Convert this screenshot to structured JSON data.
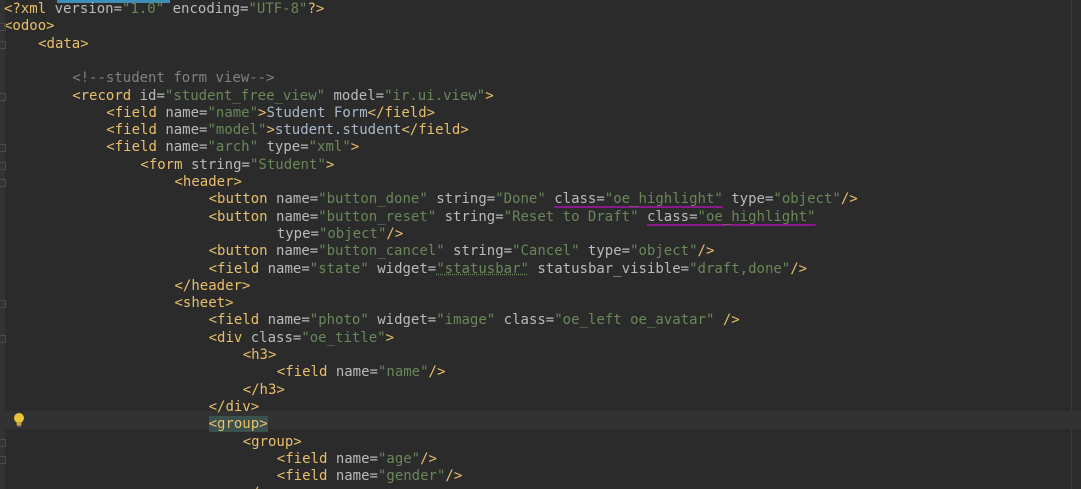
{
  "editor": {
    "language": "xml",
    "current_line": 24,
    "lines": [
      {
        "indent": 0,
        "tokens": [
          {
            "t": "pi",
            "s": "<?xml "
          },
          {
            "t": "attr",
            "s": "version="
          },
          {
            "t": "val",
            "s": "\"1.0\""
          },
          {
            "t": "attr",
            "s": " encoding="
          },
          {
            "t": "val",
            "s": "\"UTF-8\""
          },
          {
            "t": "pi",
            "s": "?>"
          }
        ]
      },
      {
        "indent": 0,
        "tokens": [
          {
            "t": "tag",
            "s": "<odoo>"
          }
        ]
      },
      {
        "indent": 1,
        "tokens": [
          {
            "t": "tag",
            "s": "<data>"
          }
        ]
      },
      {
        "indent": 0,
        "tokens": []
      },
      {
        "indent": 2,
        "tokens": [
          {
            "t": "comment",
            "s": "<!--student form view-->"
          }
        ]
      },
      {
        "indent": 2,
        "tokens": [
          {
            "t": "tag",
            "s": "<record "
          },
          {
            "t": "attr",
            "s": "id="
          },
          {
            "t": "val",
            "s": "\"student_free_view\""
          },
          {
            "t": "attr",
            "s": " model="
          },
          {
            "t": "val",
            "s": "\"ir.ui.view\""
          },
          {
            "t": "tag",
            "s": ">"
          }
        ]
      },
      {
        "indent": 3,
        "tokens": [
          {
            "t": "tag",
            "s": "<field "
          },
          {
            "t": "attr",
            "s": "name="
          },
          {
            "t": "val",
            "s": "\"name\""
          },
          {
            "t": "tag",
            "s": ">"
          },
          {
            "t": "text",
            "s": "Student Form"
          },
          {
            "t": "tag",
            "s": "</field>"
          }
        ]
      },
      {
        "indent": 3,
        "tokens": [
          {
            "t": "tag",
            "s": "<field "
          },
          {
            "t": "attr",
            "s": "name="
          },
          {
            "t": "val",
            "s": "\"model\""
          },
          {
            "t": "tag",
            "s": ">"
          },
          {
            "t": "text",
            "s": "student.student"
          },
          {
            "t": "tag",
            "s": "</field>"
          }
        ]
      },
      {
        "indent": 3,
        "tokens": [
          {
            "t": "tag",
            "s": "<field "
          },
          {
            "t": "attr",
            "s": "name="
          },
          {
            "t": "val",
            "s": "\"arch\""
          },
          {
            "t": "attr",
            "s": " type="
          },
          {
            "t": "val",
            "s": "\"xml\""
          },
          {
            "t": "tag",
            "s": ">"
          }
        ]
      },
      {
        "indent": 4,
        "tokens": [
          {
            "t": "tag",
            "s": "<form "
          },
          {
            "t": "attr",
            "s": "string="
          },
          {
            "t": "val",
            "s": "\"Student\""
          },
          {
            "t": "tag",
            "s": ">"
          }
        ]
      },
      {
        "indent": 5,
        "tokens": [
          {
            "t": "tag",
            "s": "<header>"
          }
        ]
      },
      {
        "indent": 6,
        "tokens": [
          {
            "t": "tag",
            "s": "<button "
          },
          {
            "t": "attr",
            "s": "name="
          },
          {
            "t": "val",
            "s": "\"button_done\""
          },
          {
            "t": "attr",
            "s": " string="
          },
          {
            "t": "val",
            "s": "\"Done\""
          },
          {
            "t": "attr",
            "s": " "
          },
          {
            "t": "attr",
            "s": "class=",
            "u": "purple"
          },
          {
            "t": "val",
            "s": "\"oe_highlight\"",
            "u": "purple"
          },
          {
            "t": "attr",
            "s": " type="
          },
          {
            "t": "val",
            "s": "\"object\""
          },
          {
            "t": "tag",
            "s": "/>"
          }
        ]
      },
      {
        "indent": 6,
        "tokens": [
          {
            "t": "tag",
            "s": "<button "
          },
          {
            "t": "attr",
            "s": "name="
          },
          {
            "t": "val",
            "s": "\"button_reset\""
          },
          {
            "t": "attr",
            "s": " string="
          },
          {
            "t": "val",
            "s": "\"Reset to Draft\""
          },
          {
            "t": "attr",
            "s": " "
          },
          {
            "t": "attr",
            "s": "class=",
            "u": "purple"
          },
          {
            "t": "val",
            "s": "\"oe_highlight\"",
            "u": "purple"
          }
        ]
      },
      {
        "indent": 8,
        "tokens": [
          {
            "t": "attr",
            "s": "type="
          },
          {
            "t": "val",
            "s": "\"object\""
          },
          {
            "t": "tag",
            "s": "/>"
          }
        ]
      },
      {
        "indent": 6,
        "tokens": [
          {
            "t": "tag",
            "s": "<button "
          },
          {
            "t": "attr",
            "s": "name="
          },
          {
            "t": "val",
            "s": "\"button_cancel\""
          },
          {
            "t": "attr",
            "s": " string="
          },
          {
            "t": "val",
            "s": "\"Cancel\""
          },
          {
            "t": "attr",
            "s": " type="
          },
          {
            "t": "val",
            "s": "\"object\""
          },
          {
            "t": "tag",
            "s": "/>"
          }
        ]
      },
      {
        "indent": 6,
        "tokens": [
          {
            "t": "tag",
            "s": "<field "
          },
          {
            "t": "attr",
            "s": "name="
          },
          {
            "t": "val",
            "s": "\"state\""
          },
          {
            "t": "attr",
            "s": " widget="
          },
          {
            "t": "val",
            "s": "\"statusbar\"",
            "u": "dotted"
          },
          {
            "t": "attr",
            "s": " statusbar_visible="
          },
          {
            "t": "val",
            "s": "\"draft,done\""
          },
          {
            "t": "tag",
            "s": "/>"
          }
        ]
      },
      {
        "indent": 5,
        "tokens": [
          {
            "t": "tag",
            "s": "</header>"
          }
        ]
      },
      {
        "indent": 5,
        "tokens": [
          {
            "t": "tag",
            "s": "<sheet>"
          }
        ]
      },
      {
        "indent": 6,
        "tokens": [
          {
            "t": "tag",
            "s": "<field "
          },
          {
            "t": "attr",
            "s": "name="
          },
          {
            "t": "val",
            "s": "\"photo\""
          },
          {
            "t": "attr",
            "s": " widget="
          },
          {
            "t": "val",
            "s": "\"image\""
          },
          {
            "t": "attr",
            "s": " class="
          },
          {
            "t": "val",
            "s": "\"oe_left oe_avatar\""
          },
          {
            "t": "tag",
            "s": " />"
          }
        ]
      },
      {
        "indent": 6,
        "tokens": [
          {
            "t": "tag",
            "s": "<div "
          },
          {
            "t": "attr",
            "s": "class="
          },
          {
            "t": "val",
            "s": "\"oe_title\""
          },
          {
            "t": "tag",
            "s": ">"
          }
        ]
      },
      {
        "indent": 7,
        "tokens": [
          {
            "t": "tag",
            "s": "<h3>"
          }
        ]
      },
      {
        "indent": 8,
        "tokens": [
          {
            "t": "tag",
            "s": "<field "
          },
          {
            "t": "attr",
            "s": "name="
          },
          {
            "t": "val",
            "s": "\"name\""
          },
          {
            "t": "tag",
            "s": "/>"
          }
        ]
      },
      {
        "indent": 7,
        "tokens": [
          {
            "t": "tag",
            "s": "</h3>"
          }
        ]
      },
      {
        "indent": 6,
        "tokens": [
          {
            "t": "tag",
            "s": "</div>"
          }
        ]
      },
      {
        "indent": 6,
        "tokens": [
          {
            "t": "sel",
            "s": "<group>"
          }
        ]
      },
      {
        "indent": 7,
        "tokens": [
          {
            "t": "tag",
            "s": "<group>"
          }
        ]
      },
      {
        "indent": 8,
        "tokens": [
          {
            "t": "tag",
            "s": "<field "
          },
          {
            "t": "attr",
            "s": "name="
          },
          {
            "t": "val",
            "s": "\"age\""
          },
          {
            "t": "tag",
            "s": "/>"
          }
        ]
      },
      {
        "indent": 8,
        "tokens": [
          {
            "t": "tag",
            "s": "<field "
          },
          {
            "t": "attr",
            "s": "name="
          },
          {
            "t": "val",
            "s": "\"gender\""
          },
          {
            "t": "tag",
            "s": "/>"
          }
        ]
      },
      {
        "indent": 7,
        "tokens": [
          {
            "t": "tag",
            "s": "</group>"
          }
        ]
      }
    ]
  },
  "icons": {
    "intention": "lightbulb-icon"
  },
  "colors": {
    "background": "#2b2b2b",
    "tag": "#e8bf6a",
    "attribute": "#bababa",
    "value": "#6a8759",
    "text": "#a9b7c6",
    "comment": "#808080",
    "underline": "#8a1a8a"
  }
}
